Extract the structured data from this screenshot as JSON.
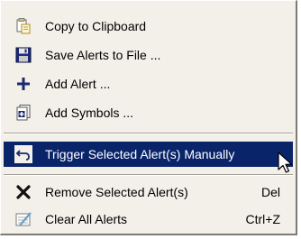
{
  "menu": {
    "items": [
      {
        "label": "Copy to Clipboard",
        "icon": "clipboard-copy-icon",
        "shortcut": ""
      },
      {
        "label": "Save Alerts to File ...",
        "icon": "floppy-disk-icon",
        "shortcut": ""
      },
      {
        "label": "Add Alert ...",
        "icon": "plus-icon",
        "shortcut": ""
      },
      {
        "label": "Add Symbols ...",
        "icon": "add-symbols-icon",
        "shortcut": ""
      },
      {
        "label": "Trigger Selected Alert(s) Manually",
        "icon": "undo-arrow-icon",
        "shortcut": "",
        "selected": true
      },
      {
        "label": "Remove Selected Alert(s)",
        "icon": "x-delete-icon",
        "shortcut": "Del"
      },
      {
        "label": "Clear All Alerts",
        "icon": "clear-all-icon",
        "shortcut": "Ctrl+Z"
      }
    ]
  },
  "colors": {
    "menu_background": "#f2f0e9",
    "selected_background": "#0a246a",
    "selected_text": "#ffffff"
  }
}
